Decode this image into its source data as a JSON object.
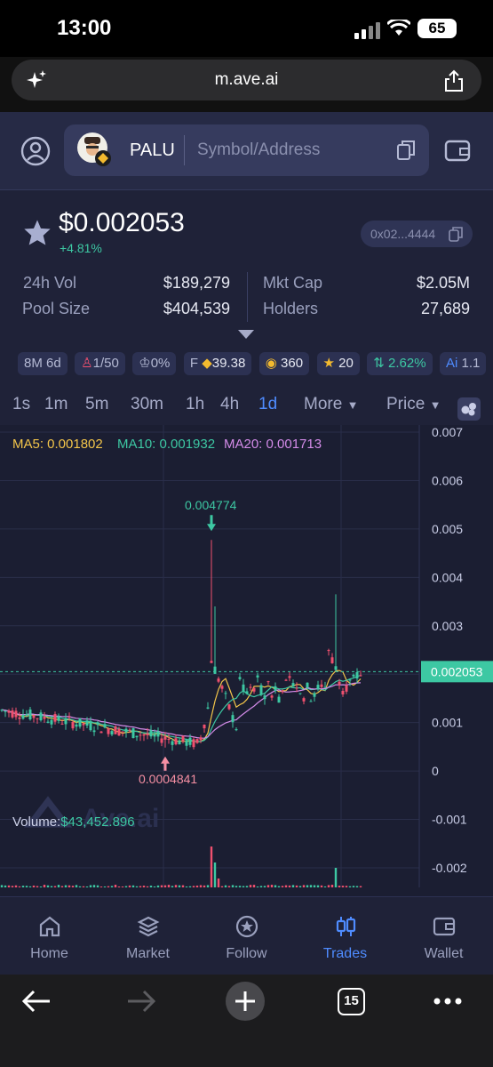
{
  "status": {
    "time": "13:00",
    "battery": "65"
  },
  "browser": {
    "url": "m.ave.ai",
    "tab_count": "15"
  },
  "search": {
    "token": "PALU",
    "placeholder": "Symbol/Address"
  },
  "token": {
    "price": "$0.002053",
    "change": "+4.81%",
    "address": "0x02...4444"
  },
  "stats": [
    {
      "label": "24h Vol",
      "value": "$189,279"
    },
    {
      "label": "Pool Size",
      "value": "$404,539"
    },
    {
      "label": "Mkt Cap",
      "value": "$2.05M"
    },
    {
      "label": "Holders",
      "value": "27,689"
    }
  ],
  "badges": [
    "8M 6d",
    "1/50",
    "0%",
    "39.38",
    "360",
    "20",
    "2.62%",
    "1.1"
  ],
  "badge_prefix_f": "F",
  "badge_prefix_ai": "Ai",
  "timeframes": [
    "1s",
    "1m",
    "5m",
    "30m",
    "1h",
    "4h",
    "1d"
  ],
  "active_timeframe": "1d",
  "controls": {
    "more": "More",
    "price": "Price"
  },
  "ma": {
    "ma5": "MA5: 0.001802",
    "ma10": "MA10: 0.001932",
    "ma20": "MA20: 0.001713"
  },
  "volume": {
    "label": "Volume:",
    "value": "$43,452.896"
  },
  "watermark": "Ave.ai",
  "chart_data": {
    "type": "candlestick",
    "y_ticks": [
      "0.007",
      "0.006",
      "0.005",
      "0.004",
      "0.003",
      "0.002",
      "0.001",
      "0",
      "-0.001",
      "-0.002"
    ],
    "ylim": [
      -0.0025,
      0.007
    ],
    "current_price": "0.002053",
    "high_label": "0.004774",
    "low_label": "0.0004841",
    "series": [
      {
        "name": "MA5",
        "color": "#f3c54a"
      },
      {
        "name": "MA10",
        "color": "#3dc8a3"
      },
      {
        "name": "MA20",
        "color": "#d38be8"
      }
    ]
  },
  "nav": [
    {
      "label": "Home",
      "icon": "home-icon"
    },
    {
      "label": "Market",
      "icon": "layers-icon"
    },
    {
      "label": "Follow",
      "icon": "star-badge-icon"
    },
    {
      "label": "Trades",
      "icon": "candles-icon"
    },
    {
      "label": "Wallet",
      "icon": "wallet-icon"
    }
  ],
  "colors": {
    "up": "#3dc8a3",
    "down": "#f0506e",
    "accent": "#4f8cff",
    "bg": "#1f2238"
  }
}
